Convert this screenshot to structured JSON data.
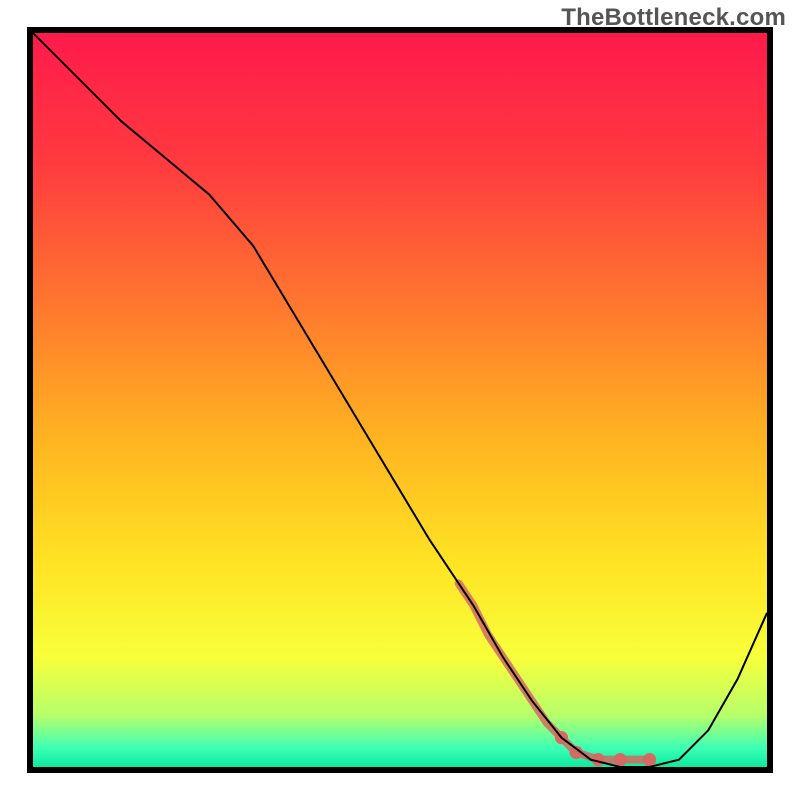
{
  "watermark": {
    "text": "TheBottleneck.com"
  },
  "chart_data": {
    "type": "line",
    "title": "",
    "xlabel": "",
    "ylabel": "",
    "xlim": [
      0,
      100
    ],
    "ylim": [
      0,
      100
    ],
    "grid": false,
    "legend": false,
    "gradient_stops": [
      {
        "offset": 0.0,
        "color": "#ff1a4b"
      },
      {
        "offset": 0.18,
        "color": "#ff3b3f"
      },
      {
        "offset": 0.38,
        "color": "#ff7a2e"
      },
      {
        "offset": 0.55,
        "color": "#ffb321"
      },
      {
        "offset": 0.72,
        "color": "#ffe324"
      },
      {
        "offset": 0.85,
        "color": "#f8ff3a"
      },
      {
        "offset": 0.93,
        "color": "#b6ff6b"
      },
      {
        "offset": 0.975,
        "color": "#3bffb6"
      },
      {
        "offset": 1.0,
        "color": "#0ee8a0"
      }
    ],
    "series": [
      {
        "name": "bottleneck-curve",
        "color": "#000000",
        "stroke_width": 2,
        "x": [
          0,
          6,
          12,
          18,
          24,
          30,
          36,
          42,
          48,
          54,
          60,
          64,
          68,
          72,
          76,
          80,
          84,
          88,
          92,
          96,
          100
        ],
        "y": [
          100,
          94,
          88,
          83,
          78,
          71,
          61,
          51,
          41,
          31,
          22,
          15,
          9,
          4,
          1,
          0,
          0,
          1,
          5,
          12,
          21
        ]
      }
    ],
    "highlight_band": {
      "name": "optimal-range-marker",
      "color": "#d46a62",
      "x_start": 58,
      "x_end": 84,
      "points": [
        {
          "x": 58,
          "y": 25
        },
        {
          "x": 60,
          "y": 22
        },
        {
          "x": 62,
          "y": 18
        },
        {
          "x": 64,
          "y": 15
        },
        {
          "x": 66,
          "y": 12
        },
        {
          "x": 68,
          "y": 9
        },
        {
          "x": 70,
          "y": 6
        },
        {
          "x": 72,
          "y": 4
        },
        {
          "x": 74,
          "y": 2
        },
        {
          "x": 77,
          "y": 1
        },
        {
          "x": 80,
          "y": 1
        },
        {
          "x": 84,
          "y": 1
        }
      ]
    }
  }
}
